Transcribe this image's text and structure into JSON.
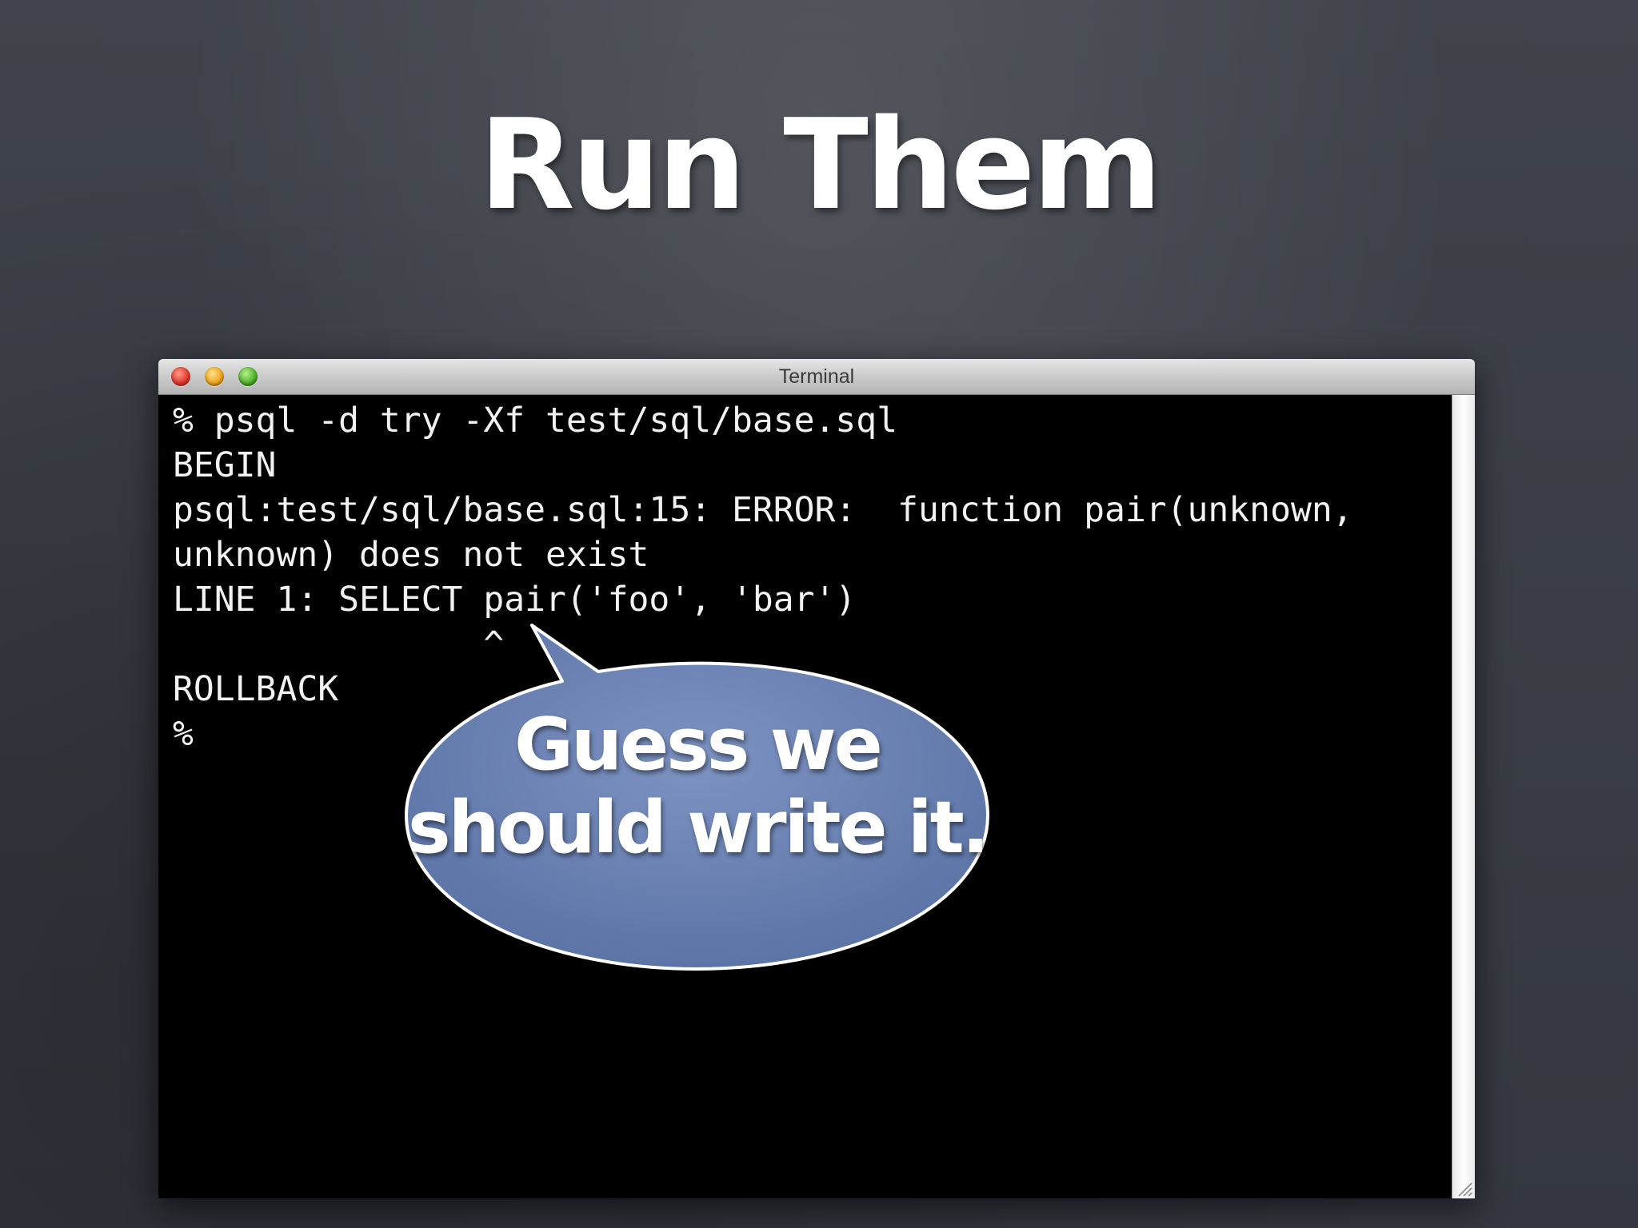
{
  "slide": {
    "title": "Run Them"
  },
  "terminal": {
    "window_title": "Terminal",
    "lines": [
      "% psql -d try -Xf test/sql/base.sql",
      "BEGIN",
      "psql:test/sql/base.sql:15: ERROR:  function pair(unknown,",
      "unknown) does not exist",
      "LINE 1: SELECT pair('foo', 'bar')",
      "               ^",
      "ROLLBACK",
      "%"
    ]
  },
  "callout": {
    "line1": "Guess we",
    "line2": "should write it.",
    "fill_color": "#6f86b6"
  },
  "colors": {
    "background": "#3a3d45",
    "terminal_bg": "#000000",
    "terminal_fg": "#f2f2f2",
    "close_button": "#e33b2e",
    "minimize_button": "#f0a622",
    "zoom_button": "#4fb42c"
  },
  "icons": [
    "close-button-icon",
    "minimize-button-icon",
    "zoom-button-icon",
    "resize-grip-icon"
  ]
}
